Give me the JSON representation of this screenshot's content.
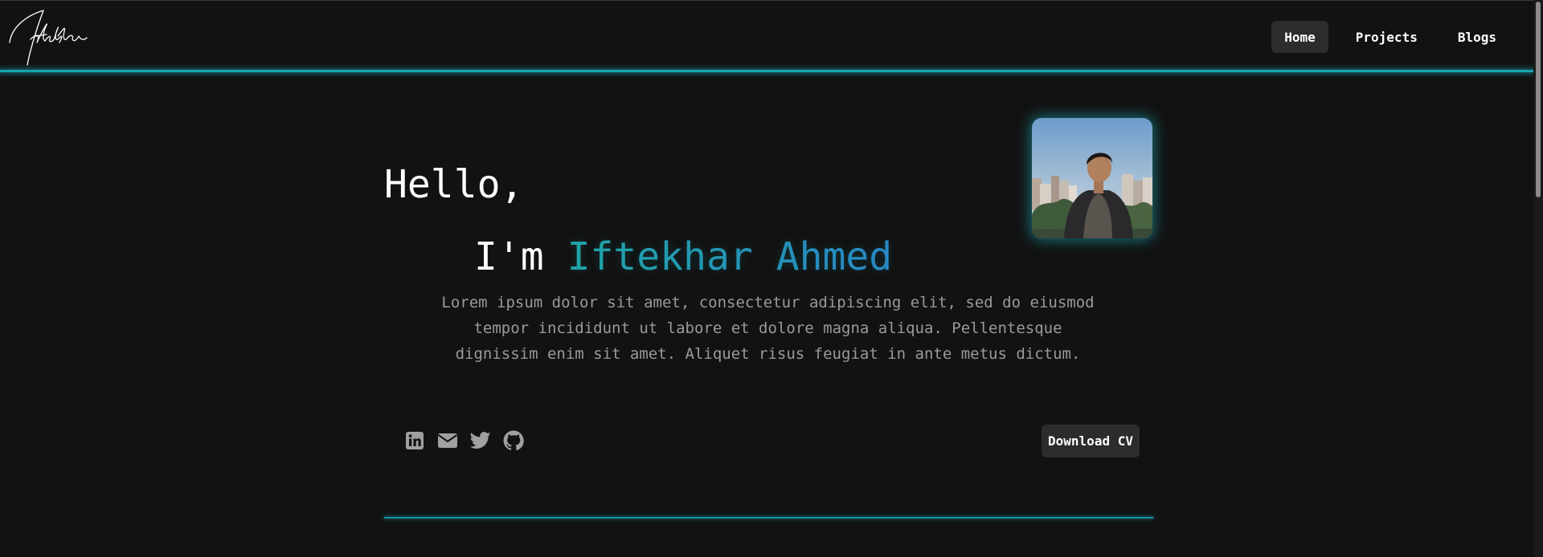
{
  "logo": {
    "alt": "Iftekhar signature logo"
  },
  "nav": {
    "items": [
      {
        "label": "Home",
        "active": true
      },
      {
        "label": "Projects",
        "active": false
      },
      {
        "label": "Blogs",
        "active": false
      }
    ]
  },
  "hero": {
    "greeting": "Hello,",
    "intro_prefix": "I'm",
    "name": "Iftekhar Ahmed",
    "bio": "Lorem ipsum dolor sit amet, consectetur adipiscing elit, sed do eiusmod tempor incididunt ut labore et dolore magna aliqua. Pellentesque dignissim enim sit amet. Aliquet risus feugiat in ante metus dictum.",
    "avatar": "profile photo"
  },
  "socials": [
    {
      "icon": "linkedin-icon"
    },
    {
      "icon": "email-icon"
    },
    {
      "icon": "twitter-icon"
    },
    {
      "icon": "github-icon"
    }
  ],
  "cv_button": {
    "label": "Download CV"
  },
  "colors": {
    "background": "#121212",
    "accent_teal": "#1aa2ad",
    "accent_blue": "#2a86c8",
    "button_bg": "#2c2c2c",
    "muted_text": "#9a9a9a"
  }
}
